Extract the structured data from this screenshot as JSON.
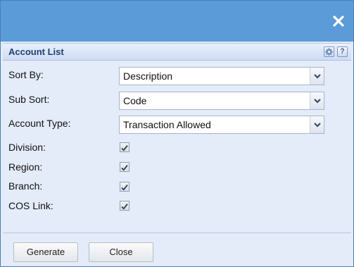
{
  "dialog": {
    "title": "Account List"
  },
  "icons": {
    "close": "close-icon",
    "settings": "gear-icon",
    "help": "help-icon",
    "dropdown": "chevron-down-icon",
    "check": "checkmark-icon"
  },
  "help_glyph": "?",
  "fields": {
    "sort_by": {
      "label": "Sort By:",
      "value": "Description"
    },
    "sub_sort": {
      "label": "Sub Sort:",
      "value": "Code"
    },
    "account_type": {
      "label": "Account Type:",
      "value": "Transaction Allowed"
    }
  },
  "checkboxes": {
    "division": {
      "label": "Division:",
      "checked": true
    },
    "region": {
      "label": "Region:",
      "checked": true
    },
    "branch": {
      "label": "Branch:",
      "checked": true
    },
    "cos_link": {
      "label": "COS Link:",
      "checked": true
    }
  },
  "buttons": {
    "generate": "Generate",
    "close": "Close"
  },
  "colors": {
    "titlebar": "#5b9bd8",
    "panel_background": "#e4ebf9",
    "panel_title_text": "#1e3f74"
  }
}
